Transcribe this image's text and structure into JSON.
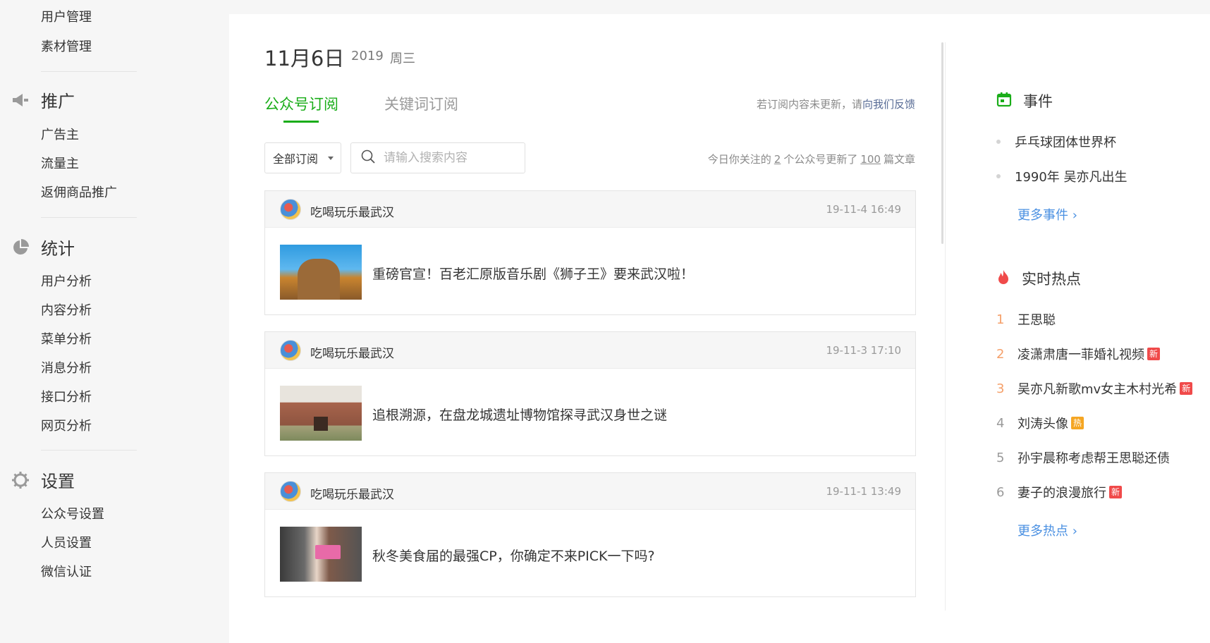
{
  "sidebar": {
    "top_items": [
      "用户管理",
      "素材管理"
    ],
    "sections": [
      {
        "title": "推广",
        "icon": "megaphone-icon",
        "items": [
          "广告主",
          "流量主",
          "返佣商品推广"
        ]
      },
      {
        "title": "统计",
        "icon": "pie-chart-icon",
        "items": [
          "用户分析",
          "内容分析",
          "菜单分析",
          "消息分析",
          "接口分析",
          "网页分析"
        ]
      },
      {
        "title": "设置",
        "icon": "gear-icon",
        "items": [
          "公众号设置",
          "人员设置",
          "微信认证"
        ]
      }
    ]
  },
  "header": {
    "date": "11月6日",
    "year": "2019",
    "weekday": "周三"
  },
  "tabs": [
    "公众号订阅",
    "关键词订阅"
  ],
  "feedback": {
    "text": "若订阅内容未更新，请",
    "link": "向我们反馈"
  },
  "filter": {
    "select_value": "全部订阅",
    "search_placeholder": "请输入搜索内容"
  },
  "stats": {
    "prefix": "今日你关注的",
    "accounts": "2",
    "middle": "个公众号更新了",
    "articles": "100",
    "suffix": "篇文章"
  },
  "articles": [
    {
      "author": "吃喝玩乐最武汉",
      "time": "19-11-4 16:49",
      "title": "重磅官宣！百老汇原版音乐剧《狮子王》要来武汉啦！"
    },
    {
      "author": "吃喝玩乐最武汉",
      "time": "19-11-3 17:10",
      "title": "追根溯源，在盘龙城遗址博物馆探寻武汉身世之谜"
    },
    {
      "author": "吃喝玩乐最武汉",
      "time": "19-11-1 13:49",
      "title": "秋冬美食届的最强CP，你确定不来PICK一下吗?"
    }
  ],
  "events": {
    "title": "事件",
    "icon": "calendar-icon",
    "items": [
      "乒乓球团体世界杯",
      "1990年 吴亦凡出生"
    ],
    "more": "更多事件 ›"
  },
  "hot": {
    "title": "实时热点",
    "icon": "flame-icon",
    "items": [
      {
        "rank": "1",
        "text": "王思聪",
        "badge": ""
      },
      {
        "rank": "2",
        "text": "凌潇肃唐一菲婚礼视频",
        "badge": "新"
      },
      {
        "rank": "3",
        "text": "吴亦凡新歌mv女主木村光希",
        "badge": "新"
      },
      {
        "rank": "4",
        "text": "刘涛头像",
        "badge": "热"
      },
      {
        "rank": "5",
        "text": "孙宇晨称考虑帮王思聪还债",
        "badge": ""
      },
      {
        "rank": "6",
        "text": "妻子的浪漫旅行",
        "badge": "新"
      }
    ],
    "more": "更多热点 ›"
  },
  "colors": {
    "accent": "#1aad19",
    "link": "#4a90e2",
    "badge_new": "#f04a4a",
    "badge_hot": "#f5a623",
    "rank_top": "#f5a06a",
    "rank_other": "#9a9a9a"
  }
}
